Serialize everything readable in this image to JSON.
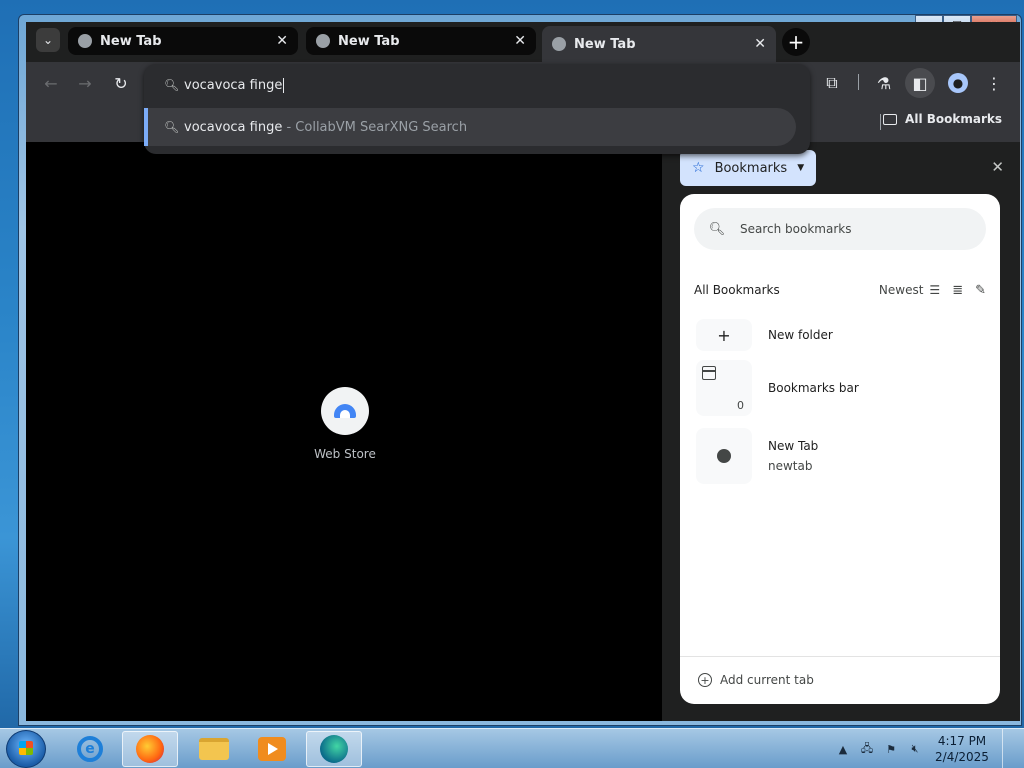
{
  "window": {
    "caption": {
      "min": "–",
      "max": "☐",
      "close": "✕"
    }
  },
  "tabs": [
    {
      "label": "New Tab",
      "state": "inactive"
    },
    {
      "label": "New Tab",
      "state": "inactive"
    },
    {
      "label": "New Tab",
      "state": "active"
    }
  ],
  "tab_icons": {
    "tab_search": "chevron-down-icon",
    "close": "✕",
    "new_tab": "+"
  },
  "toolbar": {
    "back": "←",
    "forward": "→",
    "reload": "↻",
    "extensions_icon": "puzzle-icon",
    "labs_icon": "flask-icon",
    "side_panel_icon": "side-panel-icon",
    "profile_icon": "profile-icon",
    "menu": "⋮"
  },
  "bookmarks_bar": {
    "all_bookmarks": "All Bookmarks"
  },
  "omnibox": {
    "input_value": "vocavoca finge",
    "suggestion": {
      "query": "vocavoca finge",
      "source": " - CollabVM SearXNG Search"
    }
  },
  "new_tab_page": {
    "shortcut": {
      "label": "Web Store"
    }
  },
  "side_panel": {
    "title": "Bookmarks",
    "close": "✕",
    "search_placeholder": "Search bookmarks",
    "section_title": "All Bookmarks",
    "sort_label": "Newest",
    "items": [
      {
        "title": "New folder",
        "subtitle": ""
      },
      {
        "title": "Bookmarks bar",
        "count": "0"
      },
      {
        "title": "New Tab",
        "subtitle": "newtab"
      }
    ],
    "footer_action": "Add current tab"
  },
  "taskbar": {
    "apps": [
      "internet-explorer",
      "firefox",
      "file-explorer",
      "media-player",
      "edge"
    ],
    "clock": {
      "time": "4:17 PM",
      "date": "2/4/2025"
    }
  }
}
